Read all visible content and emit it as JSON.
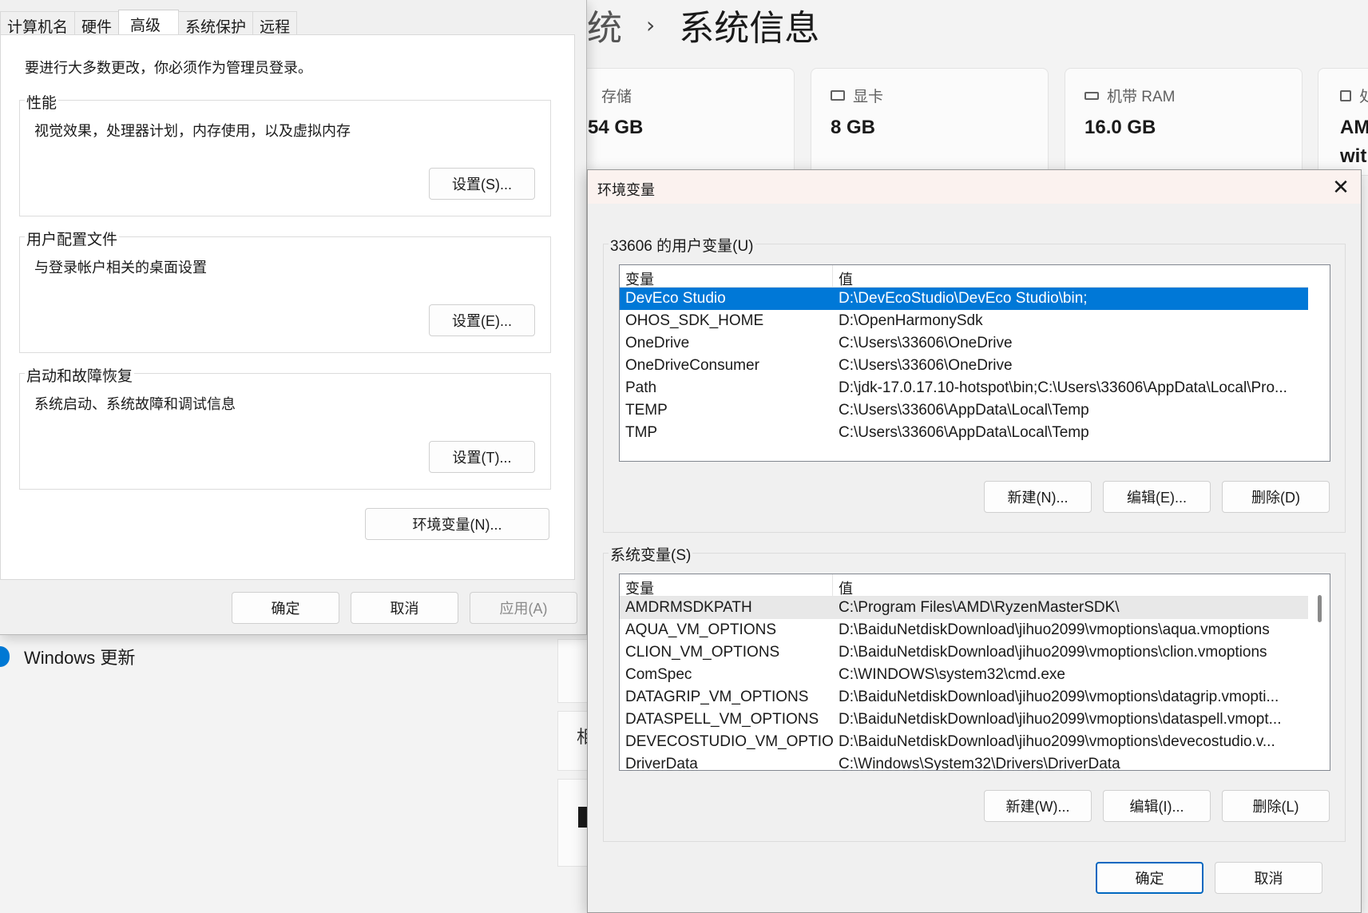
{
  "settings": {
    "breadcrumb_prev": "统",
    "breadcrumb_sep": "›",
    "page_title": "系统信息",
    "specs": [
      {
        "label": "存储",
        "value": "54 GB",
        "value2": ""
      },
      {
        "label": "显卡",
        "value": "8 GB",
        "value2": ""
      },
      {
        "label": "机带 RAM",
        "value": "16.0 GB",
        "value2": ""
      },
      {
        "label": "处",
        "value": "AM",
        "value2": "wit"
      }
    ],
    "windows_update": "Windows 更新",
    "partial_char": "相"
  },
  "sysprop": {
    "tabs": [
      "计算机名",
      "硬件",
      "高级",
      "系统保护",
      "远程"
    ],
    "active_tab": "高级",
    "admin_note": "要进行大多数更改，你必须作为管理员登录。",
    "groups": [
      {
        "title": "性能",
        "desc": "视觉效果，处理器计划，内存使用，以及虚拟内存",
        "button": "设置(S)..."
      },
      {
        "title": "用户配置文件",
        "desc": "与登录帐户相关的桌面设置",
        "button": "设置(E)..."
      },
      {
        "title": "启动和故障恢复",
        "desc": "系统启动、系统故障和调试信息",
        "button": "设置(T)..."
      }
    ],
    "env_button": "环境变量(N)...",
    "ok": "确定",
    "cancel": "取消",
    "apply": "应用(A)"
  },
  "envvars": {
    "title": "环境变量",
    "user_group_title": "33606 的用户变量(U)",
    "col_name": "变量",
    "col_value": "值",
    "user_vars": [
      {
        "name": "DevEco Studio",
        "value": "D:\\DevEcoStudio\\DevEco Studio\\bin;"
      },
      {
        "name": "OHOS_SDK_HOME",
        "value": "D:\\OpenHarmonySdk"
      },
      {
        "name": "OneDrive",
        "value": "C:\\Users\\33606\\OneDrive"
      },
      {
        "name": "OneDriveConsumer",
        "value": "C:\\Users\\33606\\OneDrive"
      },
      {
        "name": "Path",
        "value": "D:\\jdk-17.0.17.10-hotspot\\bin;C:\\Users\\33606\\AppData\\Local\\Pro..."
      },
      {
        "name": "TEMP",
        "value": "C:\\Users\\33606\\AppData\\Local\\Temp"
      },
      {
        "name": "TMP",
        "value": "C:\\Users\\33606\\AppData\\Local\\Temp"
      }
    ],
    "user_new": "新建(N)...",
    "user_edit": "编辑(E)...",
    "user_delete": "删除(D)",
    "system_group_title": "系统变量(S)",
    "system_vars": [
      {
        "name": "AMDRMSDKPATH",
        "value": "C:\\Program Files\\AMD\\RyzenMasterSDK\\"
      },
      {
        "name": "AQUA_VM_OPTIONS",
        "value": "D:\\BaiduNetdiskDownload\\jihuo2099\\vmoptions\\aqua.vmoptions"
      },
      {
        "name": "CLION_VM_OPTIONS",
        "value": "D:\\BaiduNetdiskDownload\\jihuo2099\\vmoptions\\clion.vmoptions"
      },
      {
        "name": "ComSpec",
        "value": "C:\\WINDOWS\\system32\\cmd.exe"
      },
      {
        "name": "DATAGRIP_VM_OPTIONS",
        "value": "D:\\BaiduNetdiskDownload\\jihuo2099\\vmoptions\\datagrip.vmopti..."
      },
      {
        "name": "DATASPELL_VM_OPTIONS",
        "value": "D:\\BaiduNetdiskDownload\\jihuo2099\\vmoptions\\dataspell.vmopt..."
      },
      {
        "name": "DEVECOSTUDIO_VM_OPTIO...",
        "value": "D:\\BaiduNetdiskDownload\\jihuo2099\\vmoptions\\devecostudio.v..."
      },
      {
        "name": "DriverData",
        "value": "C:\\Windows\\System32\\Drivers\\DriverData"
      }
    ],
    "system_new": "新建(W)...",
    "system_edit": "编辑(I)...",
    "system_delete": "删除(L)",
    "ok": "确定",
    "cancel": "取消"
  }
}
